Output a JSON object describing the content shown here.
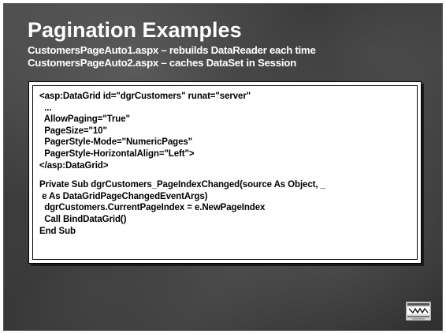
{
  "slide": {
    "title": "Pagination Examples",
    "subtitle_lines": [
      "CustomersPageAuto1.aspx – rebuilds DataReader each time",
      "CustomersPageAuto2.aspx – caches DataSet in Session"
    ],
    "code_block_1": [
      "<asp:DataGrid id=\"dgrCustomers\" runat=\"server\"",
      "  ...",
      "  AllowPaging=\"True\"",
      "  PageSize=\"10\"",
      "  PagerStyle-Mode=\"NumericPages\"",
      "  PagerStyle-HorizontalAlign=\"Left\">",
      "</asp:DataGrid>"
    ],
    "code_block_2": [
      "Private Sub dgrCustomers_PageIndexChanged(source As Object, _",
      " e As DataGridPageChangedEventArgs)",
      "  dgrCustomers.CurrentPageIndex = e.NewPageIndex",
      "  Call BindDataGrid()",
      "End Sub"
    ],
    "logo_icon": "presentation-logo-icon"
  }
}
